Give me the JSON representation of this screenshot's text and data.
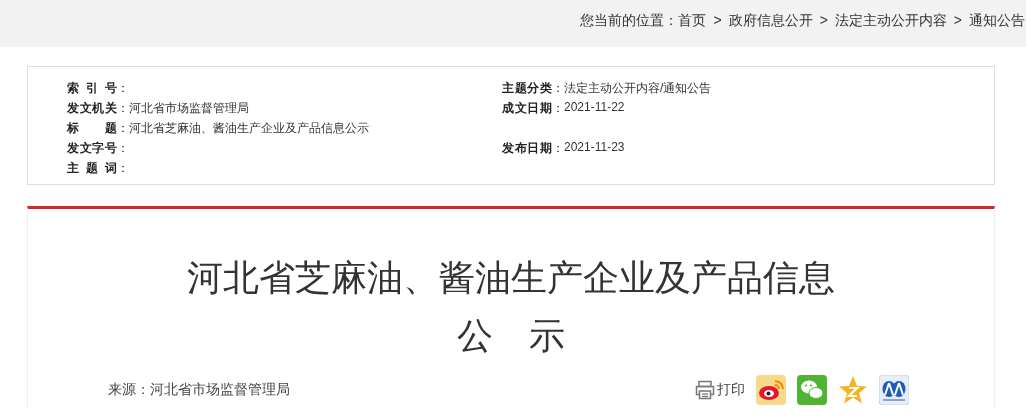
{
  "breadcrumb": {
    "label": "您当前的位置：",
    "items": [
      {
        "kind": "link",
        "text": "首页"
      },
      {
        "kind": "separator",
        "text": ">"
      },
      {
        "kind": "link",
        "text": "政府信息公开"
      },
      {
        "kind": "separator",
        "text": ">"
      },
      {
        "kind": "link",
        "text": "法定主动公开内容"
      },
      {
        "kind": "separator",
        "text": ">"
      },
      {
        "kind": "link",
        "text": "通知公告"
      }
    ]
  },
  "info": {
    "rows": [
      {
        "left": {
          "label": "索引号",
          "colon": "："
        },
        "right": {
          "label": "主题分类",
          "colon": "：",
          "value": "法定主动公开内容/通知公告"
        }
      },
      {
        "left": {
          "label": "发文机关",
          "colon": "：",
          "value": "河北省市场监督管理局"
        },
        "right": {
          "label": "成文日期",
          "colon": "：",
          "value": "2021-11-22"
        }
      },
      {
        "left": {
          "label": "标题",
          "colon": "：",
          "value": "河北省芝麻油、酱油生产企业及产品信息公示"
        }
      },
      {
        "left": {
          "label": "发文字号",
          "colon": "："
        },
        "right": {
          "label": "发布日期",
          "colon": "：",
          "value": "2021-11-23"
        }
      },
      {
        "left": {
          "label": "主题词",
          "colon": "："
        }
      }
    ]
  },
  "article": {
    "title_lines": [
      "河北省芝麻油、酱油生产企业及产品信息",
      "公　示"
    ],
    "source": "来源：河北省市场监督管理局",
    "print": "打印",
    "share": [
      {
        "kind": "eye"
      },
      {
        "kind": "chat"
      },
      {
        "kind": "star"
      },
      {
        "kind": "people"
      }
    ]
  }
}
